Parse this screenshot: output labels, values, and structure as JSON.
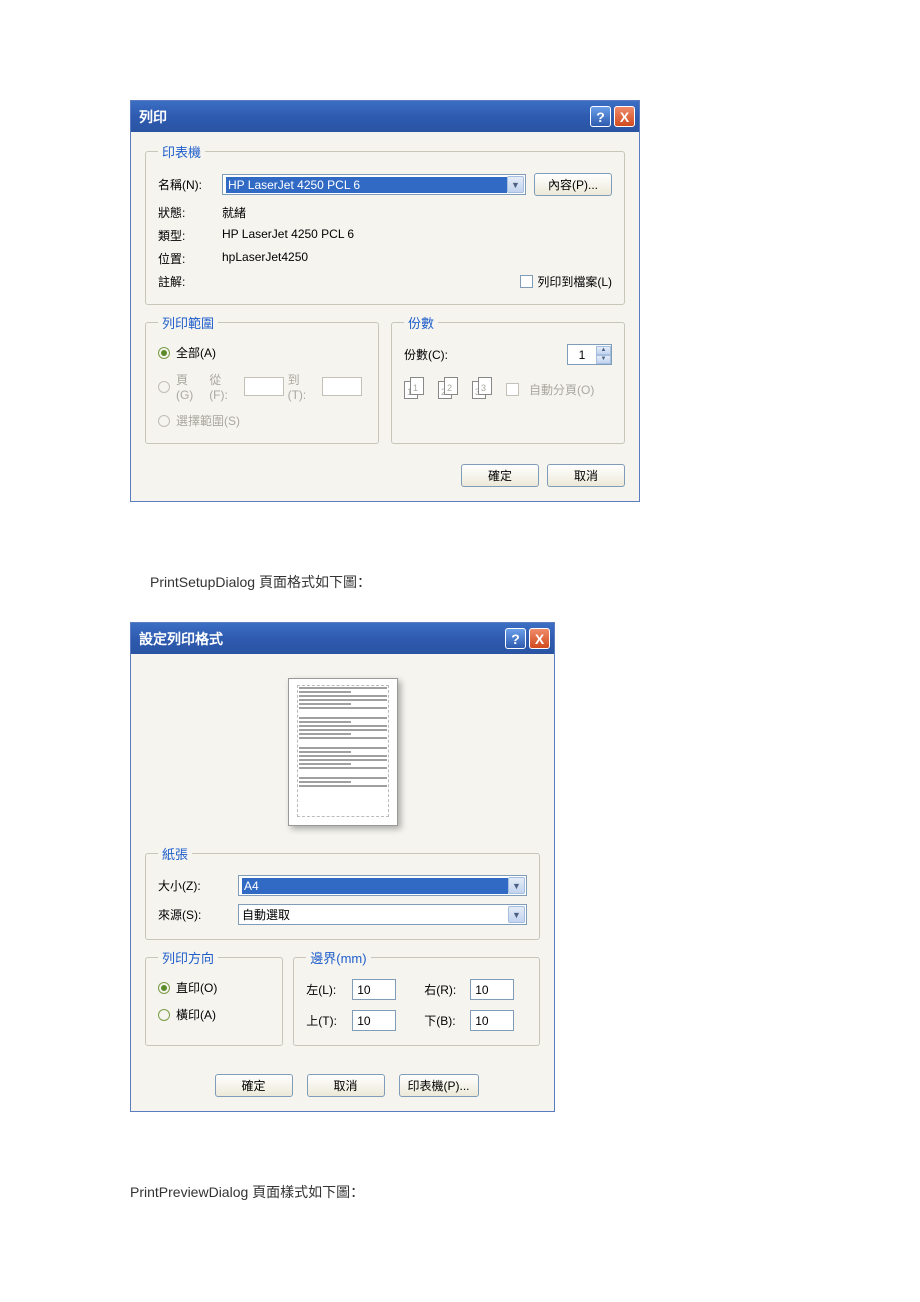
{
  "print_dialog": {
    "title": "列印",
    "help": "?",
    "close": "X",
    "printer_group": "印表機",
    "name_label": "名稱(N):",
    "name_value": "HP LaserJet 4250 PCL 6",
    "properties_btn": "內容(P)...",
    "status_label": "狀態:",
    "status_value": "就緒",
    "type_label": "類型:",
    "type_value": "HP LaserJet 4250 PCL 6",
    "location_label": "位置:",
    "location_value": "hpLaserJet4250",
    "comment_label": "註解:",
    "print_to_file": "列印到檔案(L)",
    "range_group": "列印範圍",
    "range_all": "全部(A)",
    "range_pages": "頁(G)",
    "range_from": "從(F):",
    "range_to": "到(T):",
    "range_selection": "選擇範圍(S)",
    "copies_group": "份數",
    "copies_label": "份數(C):",
    "copies_value": "1",
    "collate": "自動分頁(O)",
    "ok": "確定",
    "cancel": "取消"
  },
  "caption1": "PrintSetupDialog 頁面格式如下圖：",
  "setup_dialog": {
    "title": "設定列印格式",
    "help": "?",
    "close": "X",
    "paper_group": "紙張",
    "size_label": "大小(Z):",
    "size_value": "A4",
    "source_label": "來源(S):",
    "source_value": "自動選取",
    "orientation_group": "列印方向",
    "orientation_portrait": "直印(O)",
    "orientation_landscape": "橫印(A)",
    "margins_group": "邊界(mm)",
    "left_label": "左(L):",
    "left_value": "10",
    "right_label": "右(R):",
    "right_value": "10",
    "top_label": "上(T):",
    "top_value": "10",
    "bottom_label": "下(B):",
    "bottom_value": "10",
    "ok": "確定",
    "cancel": "取消",
    "printer_btn": "印表機(P)..."
  },
  "caption2": "PrintPreviewDialog 頁面樣式如下圖："
}
